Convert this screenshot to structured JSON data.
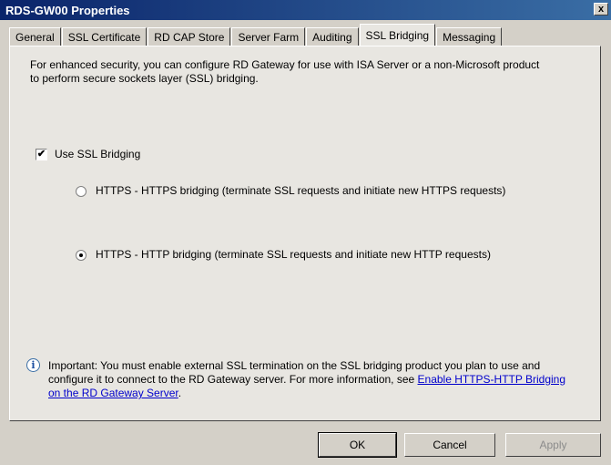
{
  "window": {
    "title": "RDS-GW00 Properties",
    "close_label": "x"
  },
  "tabs": [
    {
      "label": "General"
    },
    {
      "label": "SSL Certificate"
    },
    {
      "label": "RD CAP Store"
    },
    {
      "label": "Server Farm"
    },
    {
      "label": "Auditing"
    },
    {
      "label": "SSL Bridging",
      "selected": true
    },
    {
      "label": "Messaging"
    }
  ],
  "panel": {
    "intro": "For enhanced security, you can configure RD Gateway for use with ISA Server or a non-Microsoft product to perform secure sockets layer (SSL) bridging.",
    "use_ssl_bridging": {
      "label": "Use SSL Bridging",
      "checked": true,
      "mark": "✔"
    },
    "options": [
      {
        "label": "HTTPS - HTTPS bridging (terminate SSL requests and initiate new HTTPS requests)",
        "selected": false
      },
      {
        "label": "HTTPS - HTTP bridging (terminate SSL requests and initiate new HTTP requests)",
        "selected": true
      }
    ],
    "info": {
      "icon": "info-icon",
      "glyph": "i",
      "text": "Important: You must enable external SSL termination on the SSL bridging product you plan to use and configure it to connect to the RD Gateway server. For more information, see ",
      "link": "Enable HTTPS-HTTP Bridging on the RD Gateway Server",
      "suffix": "."
    }
  },
  "buttons": {
    "ok": "OK",
    "cancel": "Cancel",
    "apply": "Apply"
  }
}
